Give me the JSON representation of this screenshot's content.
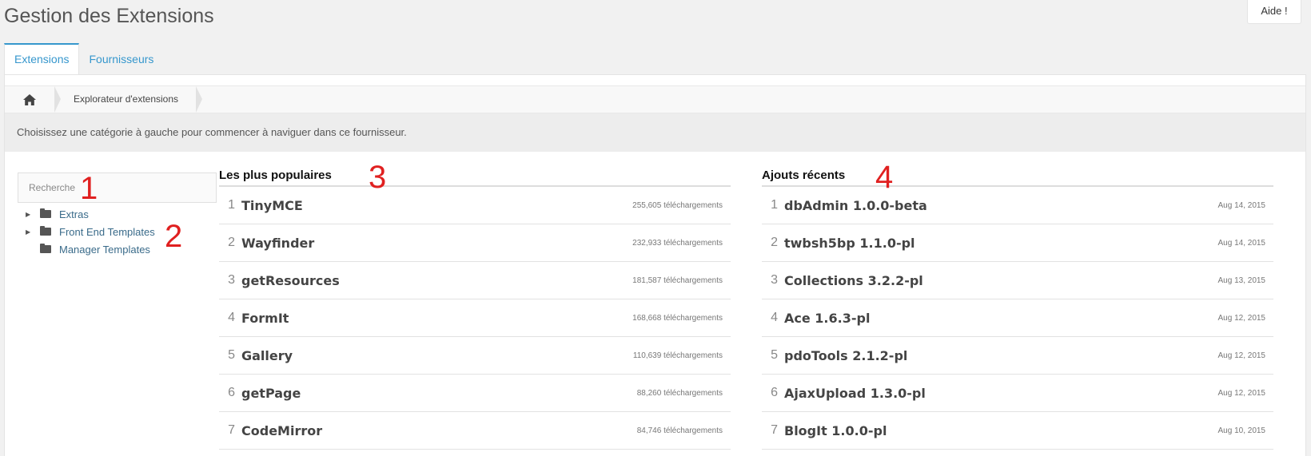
{
  "page": {
    "title": "Gestion des Extensions",
    "help_label": "Aide !"
  },
  "tabs": [
    {
      "label": "Extensions"
    },
    {
      "label": "Fournisseurs"
    }
  ],
  "breadcrumb": {
    "current": "Explorateur d'extensions"
  },
  "info": "Choisissez une catégorie à gauche pour commencer à naviguer dans ce fournisseur.",
  "search": {
    "placeholder": "Recherche",
    "value": ""
  },
  "tree": [
    {
      "label": "Extras",
      "expandable": true
    },
    {
      "label": "Front End Templates",
      "expandable": true
    },
    {
      "label": "Manager Templates",
      "expandable": false
    }
  ],
  "annotations": [
    "1",
    "2",
    "3",
    "4"
  ],
  "popular": {
    "title": "Les plus populaires",
    "items": [
      {
        "rank": "1",
        "name": "TinyMCE",
        "meta": "255,605 téléchargements"
      },
      {
        "rank": "2",
        "name": "Wayfinder",
        "meta": "232,933 téléchargements"
      },
      {
        "rank": "3",
        "name": "getResources",
        "meta": "181,587 téléchargements"
      },
      {
        "rank": "4",
        "name": "FormIt",
        "meta": "168,668 téléchargements"
      },
      {
        "rank": "5",
        "name": "Gallery",
        "meta": "110,639 téléchargements"
      },
      {
        "rank": "6",
        "name": "getPage",
        "meta": "88,260 téléchargements"
      },
      {
        "rank": "7",
        "name": "CodeMirror",
        "meta": "84,746 téléchargements"
      }
    ]
  },
  "recent": {
    "title": "Ajouts récents",
    "items": [
      {
        "rank": "1",
        "name": "dbAdmin 1.0.0-beta",
        "meta": "Aug 14, 2015"
      },
      {
        "rank": "2",
        "name": "twbsh5bp 1.1.0-pl",
        "meta": "Aug 14, 2015"
      },
      {
        "rank": "3",
        "name": "Collections 3.2.2-pl",
        "meta": "Aug 13, 2015"
      },
      {
        "rank": "4",
        "name": "Ace 1.6.3-pl",
        "meta": "Aug 12, 2015"
      },
      {
        "rank": "5",
        "name": "pdoTools 2.1.2-pl",
        "meta": "Aug 12, 2015"
      },
      {
        "rank": "6",
        "name": "AjaxUpload 1.3.0-pl",
        "meta": "Aug 12, 2015"
      },
      {
        "rank": "7",
        "name": "BlogIt 1.0.0-pl",
        "meta": "Aug 10, 2015"
      }
    ]
  }
}
